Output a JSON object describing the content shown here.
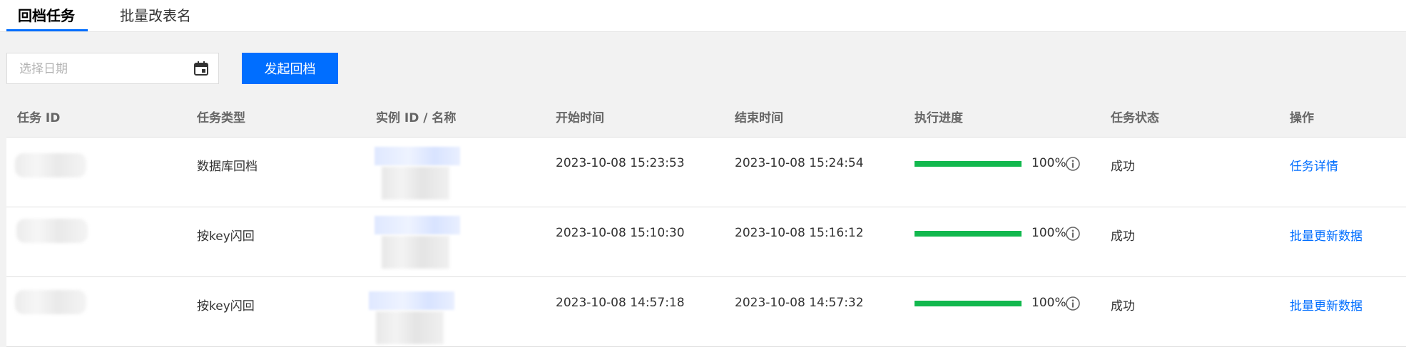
{
  "tabs": [
    {
      "label": "回档任务",
      "active": true
    },
    {
      "label": "批量改表名",
      "active": false
    }
  ],
  "toolbar": {
    "date_placeholder": "选择日期",
    "calendar_icon": "calendar-icon",
    "primary_button": "发起回档"
  },
  "table": {
    "columns": [
      "任务 ID",
      "任务类型",
      "实例 ID / 名称",
      "开始时间",
      "结束时间",
      "执行进度",
      "任务状态",
      "操作"
    ],
    "rows": [
      {
        "task_type": "数据库回档",
        "start": "2023-10-08 15:23:53",
        "end": "2023-10-08 15:24:54",
        "progress": 100,
        "progress_label": "100%",
        "status": "成功",
        "action": "任务详情"
      },
      {
        "task_type": "按key闪回",
        "start": "2023-10-08 15:10:30",
        "end": "2023-10-08 15:16:12",
        "progress": 100,
        "progress_label": "100%",
        "status": "成功",
        "action": "批量更新数据"
      },
      {
        "task_type": "按key闪回",
        "start": "2023-10-08 14:57:18",
        "end": "2023-10-08 14:57:32",
        "progress": 100,
        "progress_label": "100%",
        "status": "成功",
        "action": "批量更新数据"
      }
    ]
  },
  "colors": {
    "accent": "#006eff",
    "progress": "#12b84e",
    "link": "#006eff"
  }
}
